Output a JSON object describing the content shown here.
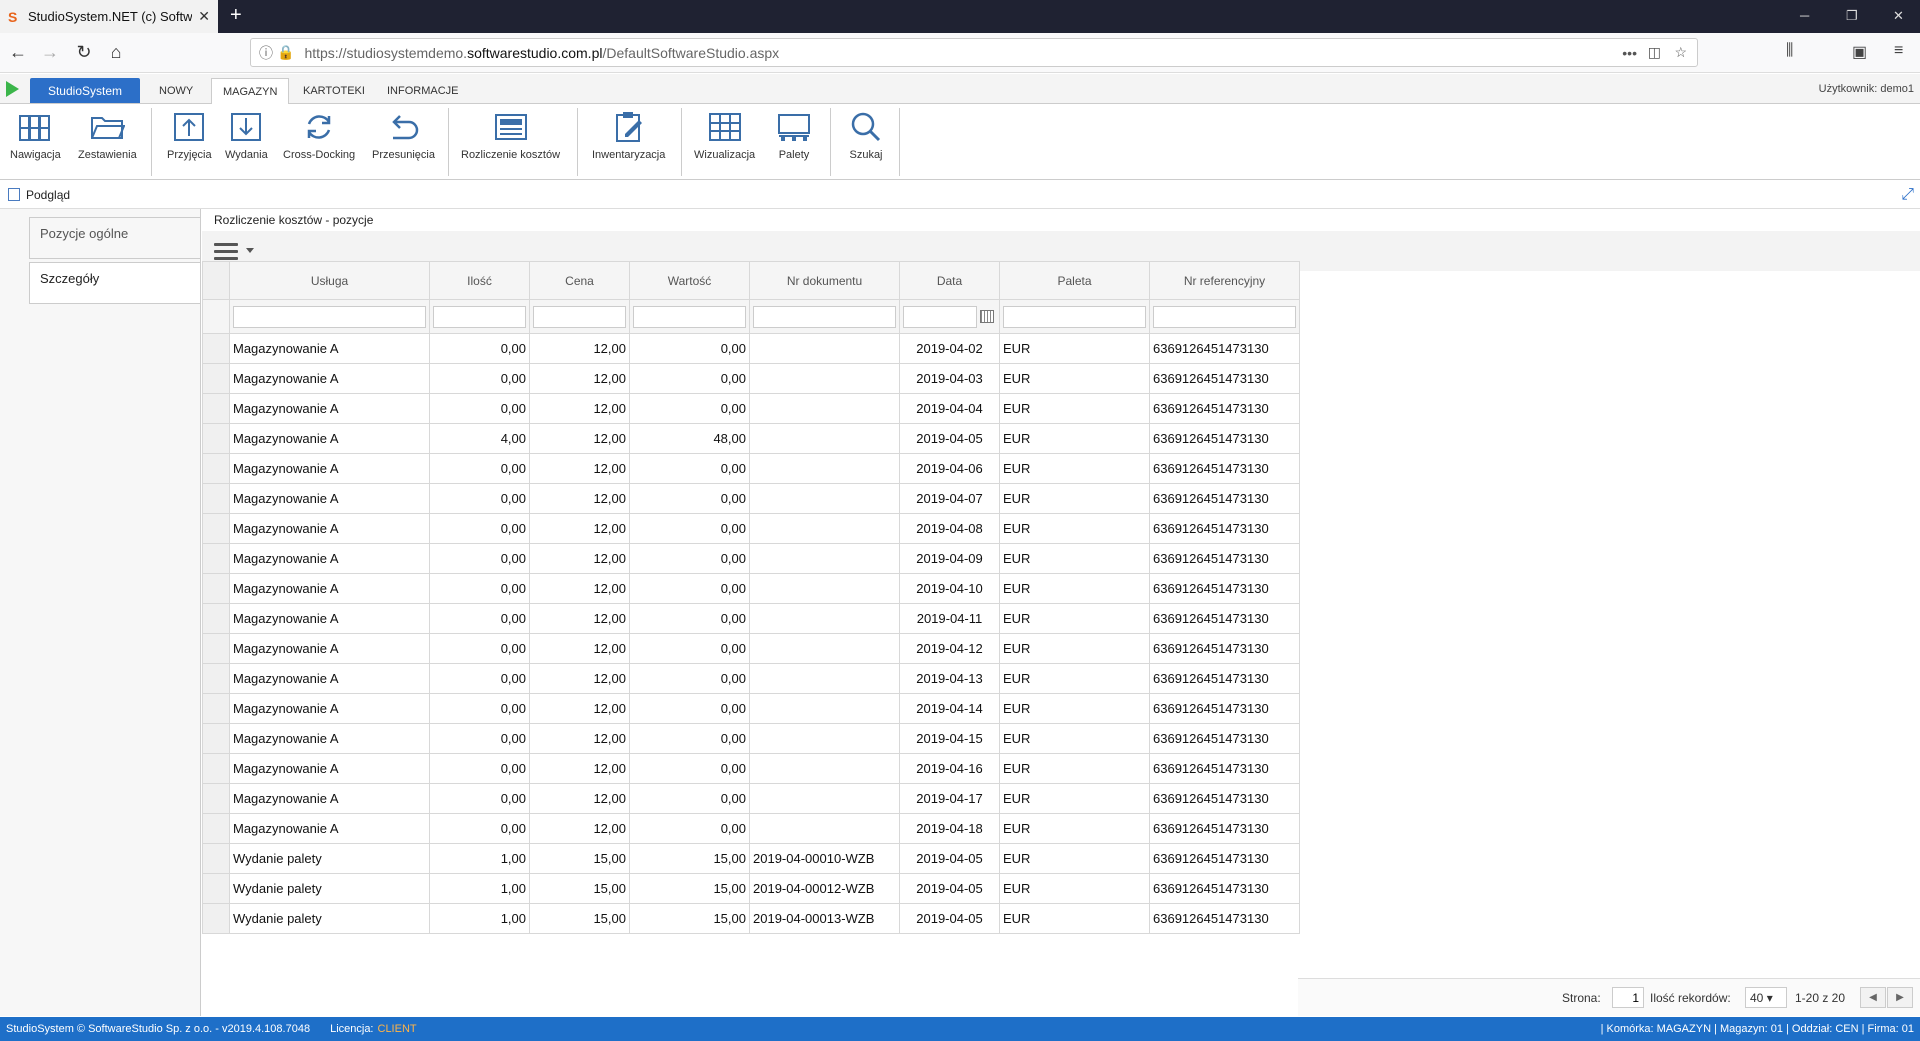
{
  "browser": {
    "tab_title": "StudioSystem.NET (c) Software",
    "url_prefix": "https://studiosystemdemo.",
    "url_domain": "softwarestudio.com.pl",
    "url_path": "/DefaultSoftwareStudio.aspx"
  },
  "app": {
    "name": "StudioSystem",
    "menu": [
      "NOWY",
      "MAGAZYN",
      "KARTOTEKI",
      "INFORMACJE"
    ],
    "user": "Użytkownik: demo1"
  },
  "ribbon": {
    "buttons": [
      "Nawigacja",
      "Zestawienia",
      "Przyjęcia",
      "Wydania",
      "Cross-Docking",
      "Przesunięcia",
      "Rozliczenie kosztów",
      "Inwentaryzacja",
      "Wizualizacja",
      "Palety",
      "Szukaj"
    ]
  },
  "preview": {
    "title": "Podgląd"
  },
  "left_panel": {
    "items": [
      "Pozycje ogólne",
      "Szczegóły"
    ]
  },
  "content": {
    "title": "Rozliczenie kosztów - pozycje"
  },
  "table": {
    "columns": [
      "Usługa",
      "Ilość",
      "Cena",
      "Wartość",
      "Nr dokumentu",
      "Data",
      "Paleta",
      "Nr referencyjny"
    ],
    "rows": [
      [
        "Magazynowanie A",
        "0,00",
        "12,00",
        "0,00",
        "",
        "2019-04-02",
        "EUR",
        "6369126451473130"
      ],
      [
        "Magazynowanie A",
        "0,00",
        "12,00",
        "0,00",
        "",
        "2019-04-03",
        "EUR",
        "6369126451473130"
      ],
      [
        "Magazynowanie A",
        "0,00",
        "12,00",
        "0,00",
        "",
        "2019-04-04",
        "EUR",
        "6369126451473130"
      ],
      [
        "Magazynowanie A",
        "4,00",
        "12,00",
        "48,00",
        "",
        "2019-04-05",
        "EUR",
        "6369126451473130"
      ],
      [
        "Magazynowanie A",
        "0,00",
        "12,00",
        "0,00",
        "",
        "2019-04-06",
        "EUR",
        "6369126451473130"
      ],
      [
        "Magazynowanie A",
        "0,00",
        "12,00",
        "0,00",
        "",
        "2019-04-07",
        "EUR",
        "6369126451473130"
      ],
      [
        "Magazynowanie A",
        "0,00",
        "12,00",
        "0,00",
        "",
        "2019-04-08",
        "EUR",
        "6369126451473130"
      ],
      [
        "Magazynowanie A",
        "0,00",
        "12,00",
        "0,00",
        "",
        "2019-04-09",
        "EUR",
        "6369126451473130"
      ],
      [
        "Magazynowanie A",
        "0,00",
        "12,00",
        "0,00",
        "",
        "2019-04-10",
        "EUR",
        "6369126451473130"
      ],
      [
        "Magazynowanie A",
        "0,00",
        "12,00",
        "0,00",
        "",
        "2019-04-11",
        "EUR",
        "6369126451473130"
      ],
      [
        "Magazynowanie A",
        "0,00",
        "12,00",
        "0,00",
        "",
        "2019-04-12",
        "EUR",
        "6369126451473130"
      ],
      [
        "Magazynowanie A",
        "0,00",
        "12,00",
        "0,00",
        "",
        "2019-04-13",
        "EUR",
        "6369126451473130"
      ],
      [
        "Magazynowanie A",
        "0,00",
        "12,00",
        "0,00",
        "",
        "2019-04-14",
        "EUR",
        "6369126451473130"
      ],
      [
        "Magazynowanie A",
        "0,00",
        "12,00",
        "0,00",
        "",
        "2019-04-15",
        "EUR",
        "6369126451473130"
      ],
      [
        "Magazynowanie A",
        "0,00",
        "12,00",
        "0,00",
        "",
        "2019-04-16",
        "EUR",
        "6369126451473130"
      ],
      [
        "Magazynowanie A",
        "0,00",
        "12,00",
        "0,00",
        "",
        "2019-04-17",
        "EUR",
        "6369126451473130"
      ],
      [
        "Magazynowanie A",
        "0,00",
        "12,00",
        "0,00",
        "",
        "2019-04-18",
        "EUR",
        "6369126451473130"
      ],
      [
        "Wydanie palety",
        "1,00",
        "15,00",
        "15,00",
        "2019-04-00010-WZB",
        "2019-04-05",
        "EUR",
        "6369126451473130"
      ],
      [
        "Wydanie palety",
        "1,00",
        "15,00",
        "15,00",
        "2019-04-00012-WZB",
        "2019-04-05",
        "EUR",
        "6369126451473130"
      ],
      [
        "Wydanie palety",
        "1,00",
        "15,00",
        "15,00",
        "2019-04-00013-WZB",
        "2019-04-05",
        "EUR",
        "6369126451473130"
      ]
    ]
  },
  "pager": {
    "page_label": "Strona:",
    "page_value": "1",
    "records_label": "Ilość rekordów:",
    "records_value": "40",
    "range": "1-20 z 20"
  },
  "status": {
    "left": "StudioSystem © SoftwareStudio Sp. z o.o. - v2019.4.108.7048",
    "license_label": "Licencja:",
    "license_value": "CLIENT",
    "right": "| Komórka: MAGAZYN | Magazyn: 01 | Oddział: CEN | Firma: 01"
  },
  "colors": {
    "accent": "#2c6fc8",
    "status_bar": "#1e6fc8",
    "play": "#3bb54a",
    "license": "#ffb347"
  }
}
